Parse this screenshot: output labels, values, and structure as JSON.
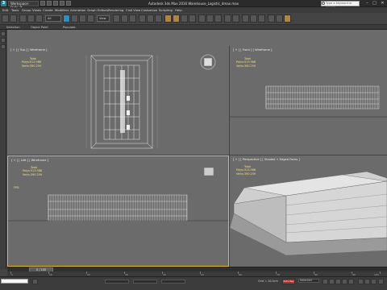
{
  "titlebar": {
    "logo": "3",
    "workspace": "Workspace: Default",
    "title": "Autodesk 3ds Max 2016     Warehouse_Logistic_4max.max",
    "search_placeholder": "Type a keyword or phrase",
    "minimize": "–",
    "maximize": "□",
    "close": "✕"
  },
  "menu": [
    "Edit",
    "Tools",
    "Group",
    "Views",
    "Create",
    "Modifiers",
    "Animation",
    "Graph Editors",
    "Rendering",
    "Civil View",
    "Customize",
    "Scripting",
    "Help"
  ],
  "toolbar": {
    "filter_dropdown": "All",
    "view_dropdown": "View"
  },
  "ribbon": {
    "labels": [
      "Selection",
      "Object Paint",
      "Populate"
    ]
  },
  "viewports": {
    "top": {
      "label": "[ + ] [ Top ] [ Wireframe ]",
      "stats_title": "Total",
      "polys_label": "Polys:",
      "polys_value": "513 988",
      "verts_label": "Verts:",
      "verts_value": "390 259"
    },
    "front": {
      "label": "[ + ] [ Front ] [ Wireframe ]",
      "stats_title": "Total",
      "polys_label": "Polys:",
      "polys_value": "513 988",
      "verts_label": "Verts:",
      "verts_value": "390 259"
    },
    "left": {
      "label": "[ + ] [ Left ] [ Wireframe ]",
      "stats_title": "Total",
      "polys_label": "Polys:",
      "polys_value": "513 988",
      "verts_label": "Verts:",
      "verts_value": "390 259",
      "fps": "FPS:"
    },
    "perspective": {
      "label": "[ + ] [ Perspective ] [ Shaded + Edged Faces ]",
      "stats_title": "Total",
      "polys_label": "Polys:",
      "polys_value": "513 988",
      "verts_label": "Verts:",
      "verts_value": "390 259"
    }
  },
  "timeline": {
    "frame": "0 / 100",
    "ticks": [
      "0",
      "10",
      "20",
      "30",
      "40",
      "50",
      "60",
      "70",
      "80",
      "90",
      "100"
    ]
  },
  "statusbar": {
    "grid": "Grid = 10,0cm",
    "autokey": "Auto Key",
    "selected": "Selected"
  },
  "colors": {
    "active_viewport_border": "#e0c000",
    "stats_text": "#f2e080",
    "viewport_bg": "#6b6b6b"
  }
}
